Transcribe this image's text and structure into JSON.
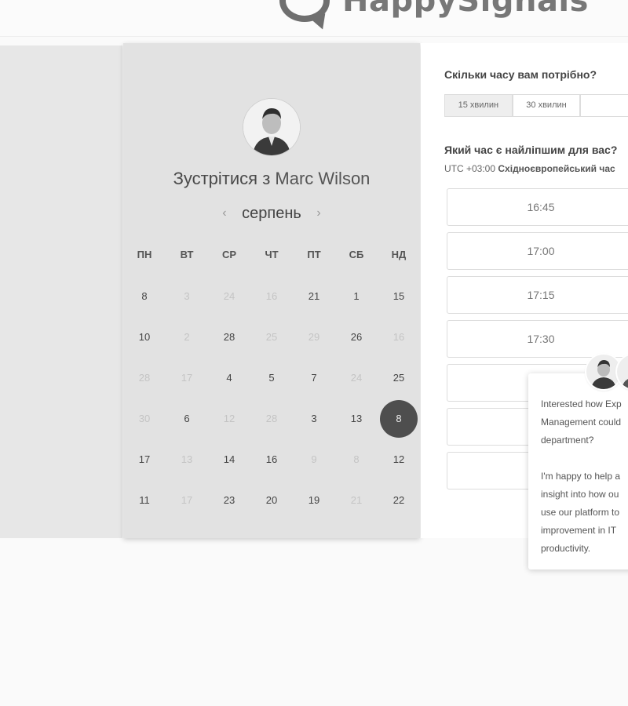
{
  "brand": {
    "name": "HappySignals"
  },
  "calendar": {
    "title_prefix": "Зустрітися з",
    "host_name": "Marc Wilson",
    "month": "серпень",
    "weekdays": [
      "ПН",
      "ВТ",
      "СР",
      "ЧТ",
      "ПТ",
      "СБ",
      "НД"
    ],
    "weeks": [
      [
        {
          "d": "8",
          "on": true
        },
        {
          "d": "3",
          "on": false
        },
        {
          "d": "24",
          "on": false
        },
        {
          "d": "16",
          "on": false
        },
        {
          "d": "21",
          "on": true
        },
        {
          "d": "1",
          "on": true
        },
        {
          "d": "15",
          "on": true
        }
      ],
      [
        {
          "d": "10",
          "on": true
        },
        {
          "d": "2",
          "on": false
        },
        {
          "d": "28",
          "on": true
        },
        {
          "d": "25",
          "on": false
        },
        {
          "d": "29",
          "on": false
        },
        {
          "d": "26",
          "on": true
        },
        {
          "d": "16",
          "on": false
        }
      ],
      [
        {
          "d": "28",
          "on": false
        },
        {
          "d": "17",
          "on": false
        },
        {
          "d": "4",
          "on": true
        },
        {
          "d": "5",
          "on": true
        },
        {
          "d": "7",
          "on": true
        },
        {
          "d": "24",
          "on": false
        },
        {
          "d": "25",
          "on": true
        }
      ],
      [
        {
          "d": "30",
          "on": false
        },
        {
          "d": "6",
          "on": true
        },
        {
          "d": "12",
          "on": false
        },
        {
          "d": "28",
          "on": false
        },
        {
          "d": "3",
          "on": true
        },
        {
          "d": "13",
          "on": true
        },
        {
          "d": "8",
          "on": true,
          "selected": true
        }
      ],
      [
        {
          "d": "17",
          "on": true
        },
        {
          "d": "13",
          "on": false
        },
        {
          "d": "14",
          "on": true
        },
        {
          "d": "16",
          "on": true
        },
        {
          "d": "9",
          "on": false
        },
        {
          "d": "8",
          "on": false
        },
        {
          "d": "12",
          "on": true
        }
      ],
      [
        {
          "d": "11",
          "on": true
        },
        {
          "d": "17",
          "on": false
        },
        {
          "d": "23",
          "on": true
        },
        {
          "d": "20",
          "on": true
        },
        {
          "d": "19",
          "on": true
        },
        {
          "d": "21",
          "on": false
        },
        {
          "d": "22",
          "on": true
        }
      ]
    ]
  },
  "booking": {
    "duration_question": "Скільки часу вам потрібно?",
    "durations": [
      "15 хвилин",
      "30 хвилин",
      ""
    ],
    "active_duration_index": 0,
    "time_question": "Який час є найліпшим для вас?",
    "timezone_offset": "UTC +03:00",
    "timezone_name": "Східноєвропейський час",
    "slots": [
      "16:45",
      "17:00",
      "17:15",
      "17:30",
      "",
      "",
      ""
    ]
  },
  "chat": {
    "lines_para1": [
      "Interested how Exp",
      "Management could",
      "department?"
    ],
    "lines_para2": [
      "I'm happy to help a",
      "insight into how ou",
      "use our platform to",
      "improvement in IT",
      "productivity."
    ]
  }
}
